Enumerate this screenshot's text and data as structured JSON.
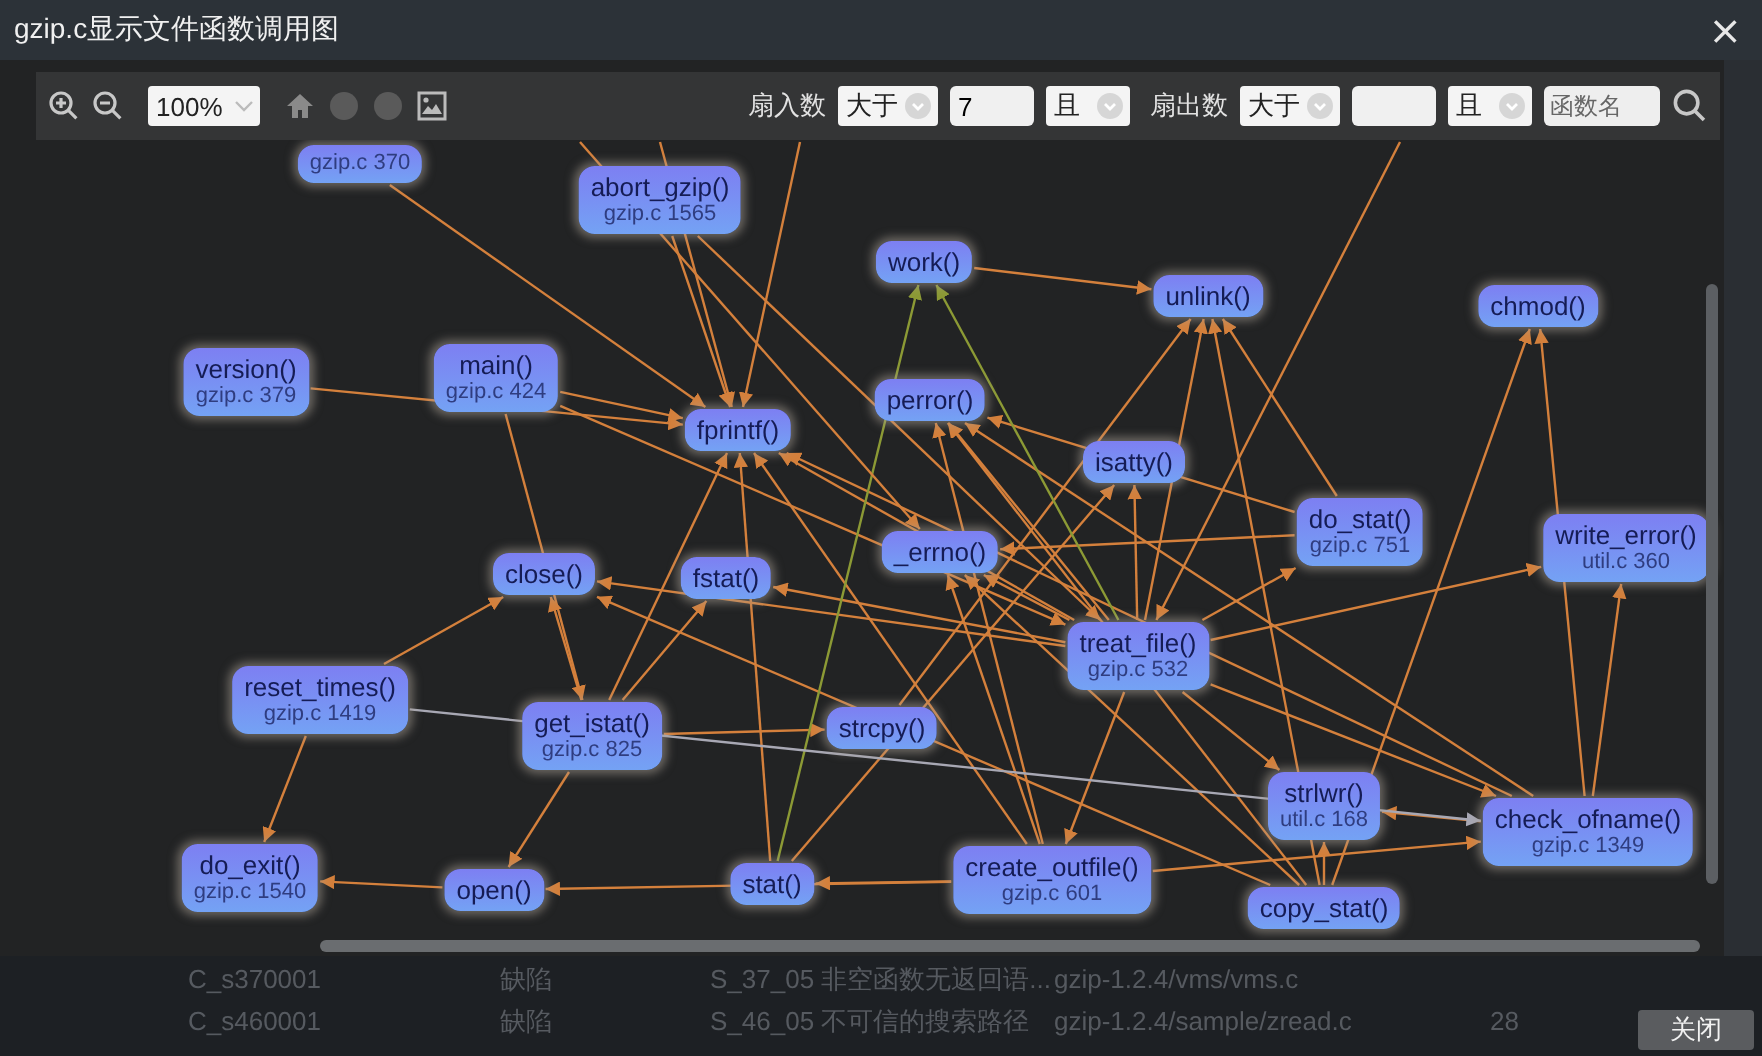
{
  "window": {
    "title": "gzip.c显示文件函数调用图",
    "close": "×"
  },
  "toolbar": {
    "zoom": "100%",
    "fan_in": {
      "label": "扇入数",
      "operator": "大于",
      "value": "7",
      "joiner": "且"
    },
    "fan_out": {
      "label": "扇出数",
      "operator": "大于",
      "joiner": "且"
    },
    "search": {
      "placeholder": "函数名"
    }
  },
  "graph": {
    "nodes": [
      {
        "location": "gzip.c 370"
      },
      {
        "name": "abort_gzip()",
        "location": "gzip.c 1565"
      },
      {
        "name": "work()"
      },
      {
        "name": "unlink()"
      },
      {
        "name": "chmod()"
      },
      {
        "name": "version()",
        "location": "gzip.c 379"
      },
      {
        "name": "main()",
        "location": "gzip.c 424"
      },
      {
        "name": "fprintf()"
      },
      {
        "name": "perror()"
      },
      {
        "name": "isatty()"
      },
      {
        "name": "do_stat()",
        "location": "gzip.c 751"
      },
      {
        "name": "write_error()",
        "location": "util.c 360"
      },
      {
        "name": "close()"
      },
      {
        "name": "fstat()"
      },
      {
        "name": "_errno()"
      },
      {
        "name": "treat_file()",
        "location": "gzip.c 532"
      },
      {
        "name": "reset_times()",
        "location": "gzip.c 1419"
      },
      {
        "name": "get_istat()",
        "location": "gzip.c 825"
      },
      {
        "name": "strcpy()"
      },
      {
        "name": "strlwr()",
        "location": "util.c 168"
      },
      {
        "name": "check_ofname()",
        "location": "gzip.c 1349"
      },
      {
        "name": "do_exit()",
        "location": "gzip.c 1540"
      },
      {
        "name": "open()"
      },
      {
        "name": "stat()"
      },
      {
        "name": "create_outfile()",
        "location": "gzip.c 601"
      },
      {
        "name": "copy_stat()"
      }
    ]
  },
  "background_rows": [
    [
      "C_s370001",
      "缺陷",
      "S_37_05 非空函数无返回语...",
      "gzip-1.2.4/vms/vms.c"
    ],
    [
      "C_s460001",
      "缺陷",
      "S_46_05 不可信的搜索路径",
      "gzip-1.2.4/sample/zread.c",
      "28"
    ]
  ],
  "footer": {
    "close_button": "关闭"
  }
}
